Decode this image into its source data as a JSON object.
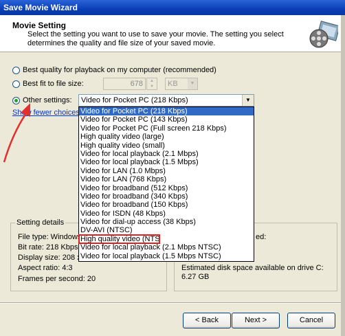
{
  "window": {
    "title": "Save Movie Wizard"
  },
  "header": {
    "title": "Movie Setting",
    "description": "Select the setting you want to use to save your movie. The setting you select determines the quality and file size of your saved movie.",
    "icon": "film-reel-icon"
  },
  "options": {
    "best_quality_label": "Best quality for playback on my computer (recommended)",
    "best_fit_label": "Best fit to file size:",
    "best_fit_value": "678",
    "best_fit_unit": "KB",
    "other_label": "Other settings:",
    "other_value": "Video for Pocket PC (218 Kbps)",
    "show_fewer": "Show fewer choices..."
  },
  "dropdown": {
    "items": [
      "Video for Pocket PC (218 Kbps)",
      "Video for Pocket PC (143 Kbps)",
      "Video for Pocket PC (Full screen 218 Kbps)",
      "High quality video (large)",
      "High quality video (small)",
      "Video for local playback (2.1 Mbps)",
      "Video for local playback (1.5 Mbps)",
      "Video for LAN (1.0 Mbps)",
      "Video for LAN (768 Kbps)",
      "Video for broadband (512 Kbps)",
      "Video for broadband (340 Kbps)",
      "Video for broadband (150 Kbps)",
      "Video for ISDN (48 Kbps)",
      "Video for dial-up access (38 Kbps)",
      "DV-AVI (NTSC)",
      "High quality video (NTSC)",
      "Video for local playback (2.1 Mbps NTSC)",
      "Video for local playback (1.5 Mbps NTSC)"
    ]
  },
  "details": {
    "title": "Setting details",
    "file_type": "File type: Windows",
    "bit_rate": "Bit rate: 218 Kbps",
    "display_size": "Display size: 208 x",
    "aspect_ratio": "Aspect ratio: 4:3",
    "fps": "Frames per second: 20"
  },
  "movie_file": {
    "partial_label": "ed:",
    "disk_space_label": "Estimated disk space available on drive C:",
    "disk_space_value": "6.27 GB"
  },
  "buttons": {
    "back": "< Back",
    "next": "Next >",
    "cancel": "Cancel"
  }
}
